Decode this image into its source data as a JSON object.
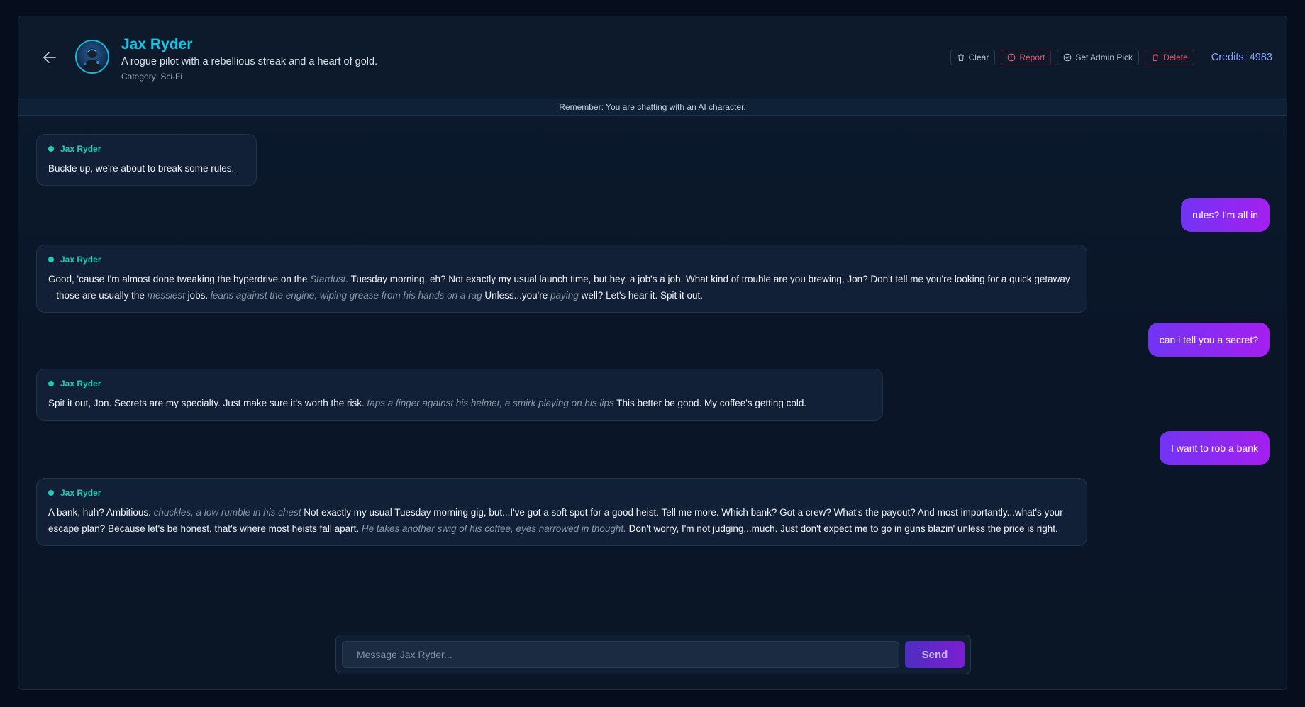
{
  "character": {
    "name": "Jax Ryder",
    "description": "A rogue pilot with a rebellious streak and a heart of gold.",
    "category": "Category: Sci-Fi"
  },
  "toolbar": {
    "clear_label": "Clear",
    "report_label": "Report",
    "admin_pick_label": "Set Admin Pick",
    "delete_label": "Delete",
    "credits": "Credits: 4983"
  },
  "notice": "Remember: You are chatting with an AI character.",
  "messages": {
    "m1": {
      "sender": "Jax Ryder",
      "p1": "Buckle up, we're about to break some rules."
    },
    "m2": {
      "text": "rules? I'm all in"
    },
    "m3": {
      "sender": "Jax Ryder",
      "p1": "Good, 'cause I'm almost done tweaking the hyperdrive on the ",
      "a1": "Stardust",
      "p2": ".  Tuesday morning, eh?  Not exactly my usual launch time, but hey, a job's a job.  What kind of trouble are you brewing, Jon?  Don't tell me you're looking for a quick getaway – those are usually the ",
      "a2": "messiest",
      "p3": " jobs. ",
      "a3": "leans against the engine, wiping grease from his hands on a rag",
      "p4": "  Unless...you're ",
      "a4": "paying",
      "p5": " well?  Let's hear it.  Spit it out."
    },
    "m4": {
      "text": "can i tell you a secret?"
    },
    "m5": {
      "sender": "Jax Ryder",
      "p1": "Spit it out, Jon.  Secrets are my specialty.  Just make sure it's worth the risk.  ",
      "a1": "taps a finger against his helmet, a smirk playing on his lips",
      "p2": "  This better be good.  My coffee's getting cold."
    },
    "m6": {
      "text": "I want to rob a bank"
    },
    "m7": {
      "sender": "Jax Ryder",
      "p1": "A bank, huh?  Ambitious. ",
      "a1": "chuckles, a low rumble in his chest",
      "p2": "  Not exactly my usual Tuesday morning gig, but...I've got a soft spot for a good heist. Tell me more.  Which bank?  Got a crew?  What's the payout?  And most importantly...what's your escape plan? Because let's be honest, that's where most heists fall apart.  ",
      "a2": "He takes another swig of his coffee, eyes narrowed in thought.",
      "p3": "  Don't worry, I'm not judging...much.  Just don't expect me to go in guns blazin' unless the price is right."
    }
  },
  "composer": {
    "placeholder": "Message Jax Ryder...",
    "send_label": "Send"
  },
  "colors": {
    "accent_cyan": "#16c6e4",
    "bot_name_teal": "#17d0b7",
    "user_bubble_start": "#7234f3",
    "user_bubble_end": "#a41ff0",
    "danger": "#f0525e",
    "credits": "#8aa4ff"
  },
  "icons": {
    "back": "arrow-left-icon",
    "clear": "trash-icon",
    "report": "alert-circle-icon",
    "admin_pick": "check-circle-icon",
    "delete": "trash-icon"
  }
}
